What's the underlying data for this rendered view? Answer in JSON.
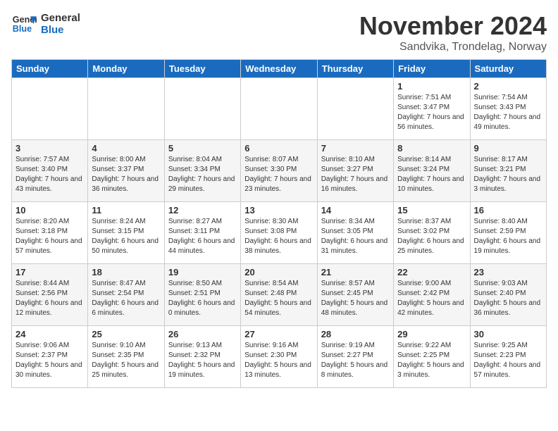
{
  "header": {
    "logo_line1": "General",
    "logo_line2": "Blue",
    "month_title": "November 2024",
    "location": "Sandvika, Trondelag, Norway"
  },
  "days_of_week": [
    "Sunday",
    "Monday",
    "Tuesday",
    "Wednesday",
    "Thursday",
    "Friday",
    "Saturday"
  ],
  "weeks": [
    [
      {
        "day": "",
        "content": ""
      },
      {
        "day": "",
        "content": ""
      },
      {
        "day": "",
        "content": ""
      },
      {
        "day": "",
        "content": ""
      },
      {
        "day": "",
        "content": ""
      },
      {
        "day": "1",
        "content": "Sunrise: 7:51 AM\nSunset: 3:47 PM\nDaylight: 7 hours and 56 minutes."
      },
      {
        "day": "2",
        "content": "Sunrise: 7:54 AM\nSunset: 3:43 PM\nDaylight: 7 hours and 49 minutes."
      }
    ],
    [
      {
        "day": "3",
        "content": "Sunrise: 7:57 AM\nSunset: 3:40 PM\nDaylight: 7 hours and 43 minutes."
      },
      {
        "day": "4",
        "content": "Sunrise: 8:00 AM\nSunset: 3:37 PM\nDaylight: 7 hours and 36 minutes."
      },
      {
        "day": "5",
        "content": "Sunrise: 8:04 AM\nSunset: 3:34 PM\nDaylight: 7 hours and 29 minutes."
      },
      {
        "day": "6",
        "content": "Sunrise: 8:07 AM\nSunset: 3:30 PM\nDaylight: 7 hours and 23 minutes."
      },
      {
        "day": "7",
        "content": "Sunrise: 8:10 AM\nSunset: 3:27 PM\nDaylight: 7 hours and 16 minutes."
      },
      {
        "day": "8",
        "content": "Sunrise: 8:14 AM\nSunset: 3:24 PM\nDaylight: 7 hours and 10 minutes."
      },
      {
        "day": "9",
        "content": "Sunrise: 8:17 AM\nSunset: 3:21 PM\nDaylight: 7 hours and 3 minutes."
      }
    ],
    [
      {
        "day": "10",
        "content": "Sunrise: 8:20 AM\nSunset: 3:18 PM\nDaylight: 6 hours and 57 minutes."
      },
      {
        "day": "11",
        "content": "Sunrise: 8:24 AM\nSunset: 3:15 PM\nDaylight: 6 hours and 50 minutes."
      },
      {
        "day": "12",
        "content": "Sunrise: 8:27 AM\nSunset: 3:11 PM\nDaylight: 6 hours and 44 minutes."
      },
      {
        "day": "13",
        "content": "Sunrise: 8:30 AM\nSunset: 3:08 PM\nDaylight: 6 hours and 38 minutes."
      },
      {
        "day": "14",
        "content": "Sunrise: 8:34 AM\nSunset: 3:05 PM\nDaylight: 6 hours and 31 minutes."
      },
      {
        "day": "15",
        "content": "Sunrise: 8:37 AM\nSunset: 3:02 PM\nDaylight: 6 hours and 25 minutes."
      },
      {
        "day": "16",
        "content": "Sunrise: 8:40 AM\nSunset: 2:59 PM\nDaylight: 6 hours and 19 minutes."
      }
    ],
    [
      {
        "day": "17",
        "content": "Sunrise: 8:44 AM\nSunset: 2:56 PM\nDaylight: 6 hours and 12 minutes."
      },
      {
        "day": "18",
        "content": "Sunrise: 8:47 AM\nSunset: 2:54 PM\nDaylight: 6 hours and 6 minutes."
      },
      {
        "day": "19",
        "content": "Sunrise: 8:50 AM\nSunset: 2:51 PM\nDaylight: 6 hours and 0 minutes."
      },
      {
        "day": "20",
        "content": "Sunrise: 8:54 AM\nSunset: 2:48 PM\nDaylight: 5 hours and 54 minutes."
      },
      {
        "day": "21",
        "content": "Sunrise: 8:57 AM\nSunset: 2:45 PM\nDaylight: 5 hours and 48 minutes."
      },
      {
        "day": "22",
        "content": "Sunrise: 9:00 AM\nSunset: 2:42 PM\nDaylight: 5 hours and 42 minutes."
      },
      {
        "day": "23",
        "content": "Sunrise: 9:03 AM\nSunset: 2:40 PM\nDaylight: 5 hours and 36 minutes."
      }
    ],
    [
      {
        "day": "24",
        "content": "Sunrise: 9:06 AM\nSunset: 2:37 PM\nDaylight: 5 hours and 30 minutes."
      },
      {
        "day": "25",
        "content": "Sunrise: 9:10 AM\nSunset: 2:35 PM\nDaylight: 5 hours and 25 minutes."
      },
      {
        "day": "26",
        "content": "Sunrise: 9:13 AM\nSunset: 2:32 PM\nDaylight: 5 hours and 19 minutes."
      },
      {
        "day": "27",
        "content": "Sunrise: 9:16 AM\nSunset: 2:30 PM\nDaylight: 5 hours and 13 minutes."
      },
      {
        "day": "28",
        "content": "Sunrise: 9:19 AM\nSunset: 2:27 PM\nDaylight: 5 hours and 8 minutes."
      },
      {
        "day": "29",
        "content": "Sunrise: 9:22 AM\nSunset: 2:25 PM\nDaylight: 5 hours and 3 minutes."
      },
      {
        "day": "30",
        "content": "Sunrise: 9:25 AM\nSunset: 2:23 PM\nDaylight: 4 hours and 57 minutes."
      }
    ]
  ]
}
